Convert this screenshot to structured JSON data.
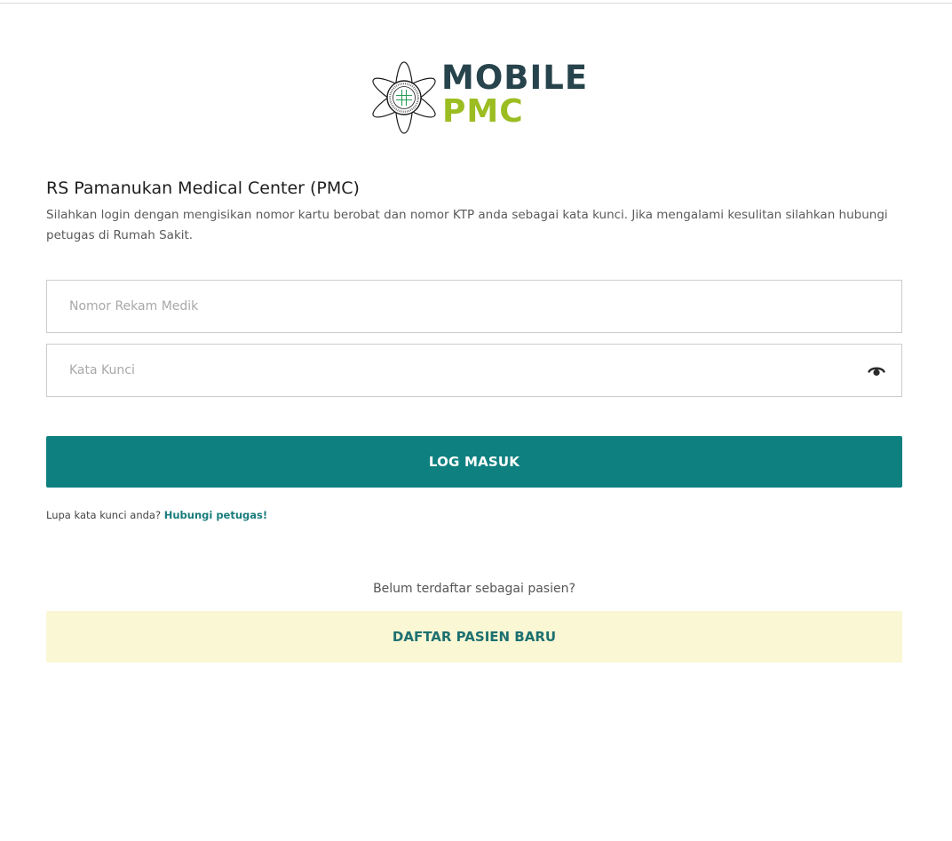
{
  "brand": {
    "logo_line1": "MOBILE",
    "logo_line2": "PMC",
    "emblem_icon": "hospital-emblem-icon",
    "colors": {
      "primary_dark": "#27434c",
      "accent_green": "#9cbd22",
      "teal": "#0f8080",
      "register_bg": "#f9f7d4"
    }
  },
  "header": {
    "title": "RS Pamanukan Medical Center (PMC)",
    "description": "Silahkan login dengan mengisikan nomor kartu berobat dan nomor KTP anda sebagai kata kunci. Jika mengalami kesulitan silahkan hubungi petugas di Rumah Sakit."
  },
  "form": {
    "medical_record": {
      "placeholder": "Nomor Rekam Medik",
      "value": ""
    },
    "password": {
      "placeholder": "Kata Kunci",
      "value": "",
      "toggle_icon": "eye-icon"
    },
    "login_button": "LOG MASUK",
    "forgot_text": "Lupa kata kunci anda?",
    "forgot_link": "Hubungi petugas!"
  },
  "register": {
    "prompt": "Belum terdaftar sebagai pasien?",
    "button": "DAFTAR PASIEN BARU"
  }
}
